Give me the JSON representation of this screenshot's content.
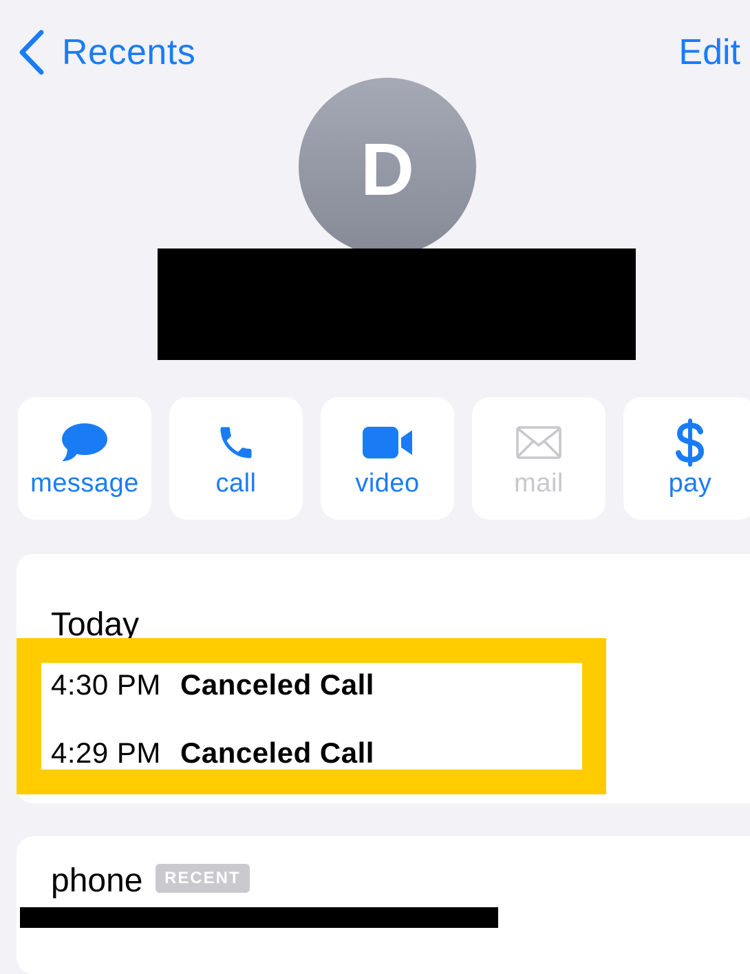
{
  "nav": {
    "back_label": "Recents",
    "edit_label": "Edit"
  },
  "contact": {
    "initial": "D"
  },
  "actions": [
    {
      "label": "message",
      "icon": "message-bubble-icon",
      "enabled": true
    },
    {
      "label": "call",
      "icon": "phone-icon",
      "enabled": true
    },
    {
      "label": "video",
      "icon": "video-camera-icon",
      "enabled": true
    },
    {
      "label": "mail",
      "icon": "envelope-icon",
      "enabled": false
    },
    {
      "label": "pay",
      "icon": "dollar-icon",
      "enabled": true
    }
  ],
  "history": {
    "heading": "Today",
    "calls": [
      {
        "time": "4:30 PM",
        "status": "Canceled Call"
      },
      {
        "time": "4:29 PM",
        "status": "Canceled Call"
      }
    ]
  },
  "phone": {
    "label": "phone",
    "badge": "RECENT"
  },
  "colors": {
    "accent": "#1a7cf5",
    "background": "#f2f2f7",
    "highlight": "#ffcc00",
    "disabled": "#c7c7cc"
  }
}
